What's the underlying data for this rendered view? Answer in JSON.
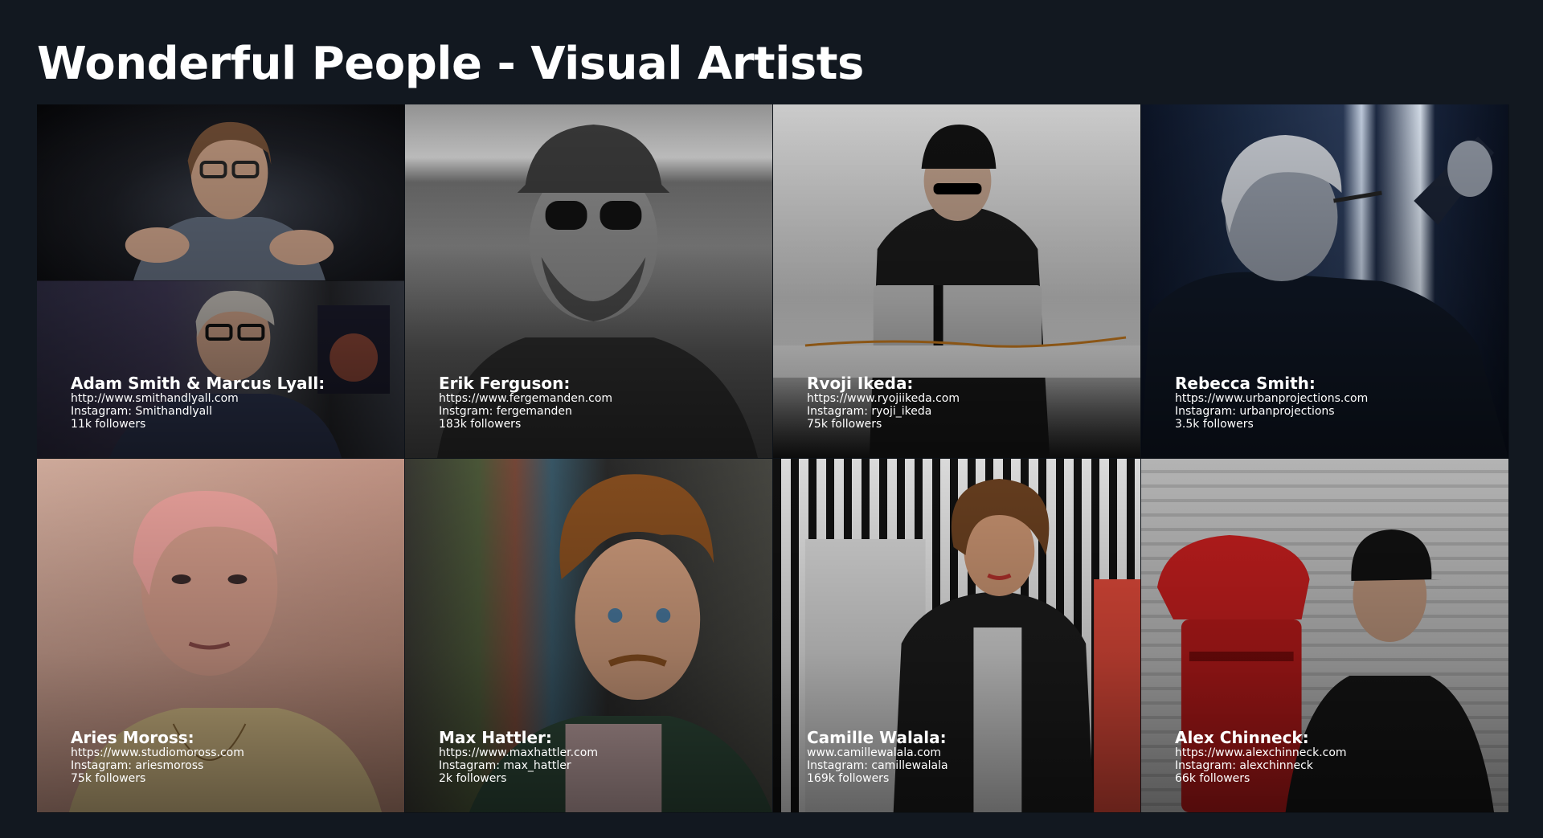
{
  "page": {
    "title": "Wonderful People - Visual Artists"
  },
  "artists": [
    {
      "name": "Adam Smith & Marcus Lyall:",
      "url": "http://www.smithandlyall.com",
      "instagram": "Instagram: Smithandlyall",
      "followers": "11k followers"
    },
    {
      "name": "Erik Ferguson:",
      "url": "https://www.fergemanden.com",
      "instagram": "Instgram: fergemanden",
      "followers": "183k followers"
    },
    {
      "name": "Rvoji Ikeda:",
      "url": "https://www.ryojiikeda.com",
      "instagram": "Instagram: ryoji_ikeda",
      "followers": "75k followers"
    },
    {
      "name": "Rebecca Smith:",
      "url": "https://www.urbanprojections.com",
      "instagram": "Instagram: urbanprojections",
      "followers": "3.5k followers"
    },
    {
      "name": "Aries Moross:",
      "url": "https://www.studiomoross.com",
      "instagram": "Instagram: ariesmoross",
      "followers": "75k followers"
    },
    {
      "name": "Max Hattler:",
      "url": "https://www.maxhattler.com",
      "instagram": "Instagram: max_hattler",
      "followers": "2k followers"
    },
    {
      "name": "Camille Walala:",
      "url": "www.camillewalala.com",
      "instagram": "Instagram: camillewalala",
      "followers": "169k followers"
    },
    {
      "name": "Alex Chinneck:",
      "url": "https://www.alexchinneck.com",
      "instagram": "Instagram: alexchinneck",
      "followers": "66k followers"
    }
  ]
}
